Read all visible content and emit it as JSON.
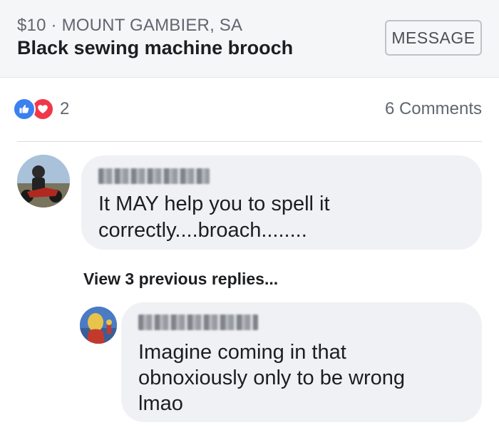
{
  "listing": {
    "meta": "$10 · MOUNT GAMBIER, SA",
    "title": "Black sewing machine brooch",
    "message_button": "MESSAGE"
  },
  "reactions": {
    "icons": [
      "like-icon",
      "love-icon"
    ],
    "count": "2",
    "comments_count": "6 Comments",
    "colors": {
      "like": "#3b80f0",
      "love": "#f0384a"
    }
  },
  "comments": [
    {
      "author_blurred": true,
      "text": "It MAY help you to spell it\ncorrectly....broach........"
    },
    {
      "author_blurred": true,
      "text": "Imagine coming in that\nobnoxiously only to be wrong\nlmao"
    }
  ],
  "view_previous_replies": "View 3 previous replies..."
}
